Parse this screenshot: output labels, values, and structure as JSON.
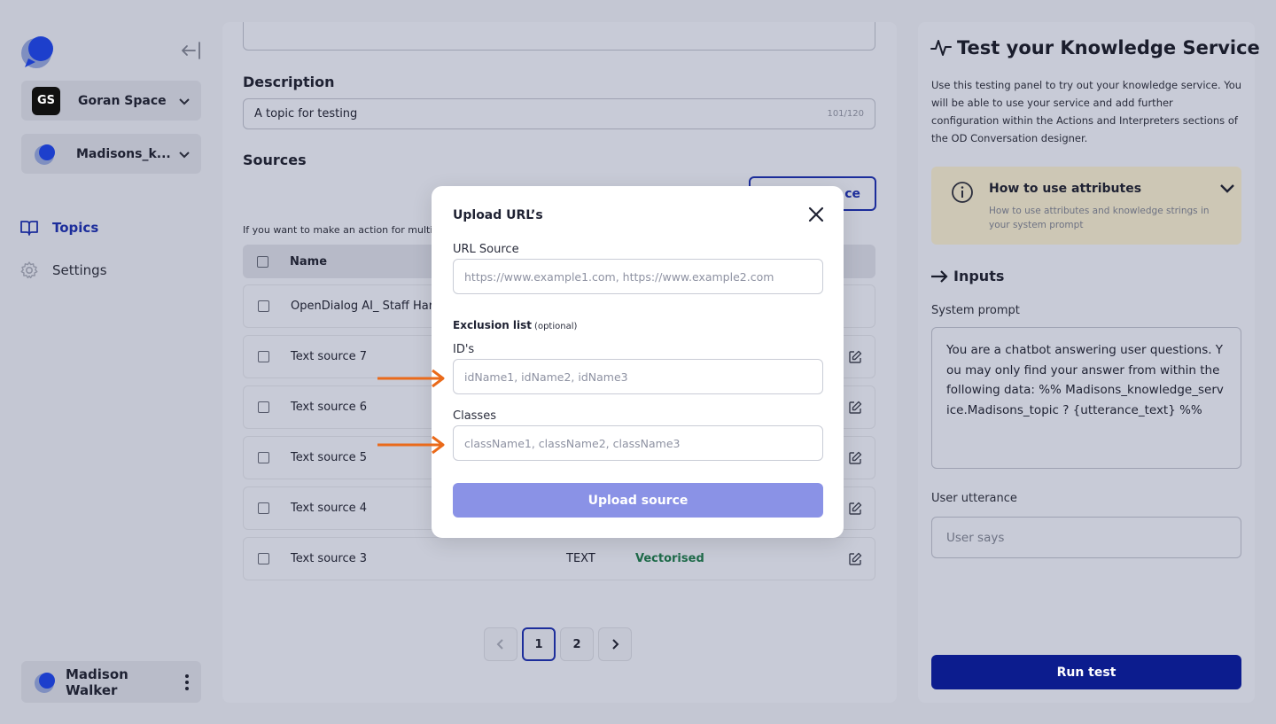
{
  "sidebar": {
    "workspace": {
      "initials": "GS",
      "name": "Goran Space"
    },
    "service": {
      "name": "Madisons_k..."
    },
    "nav": [
      {
        "label": "Topics",
        "icon": "book-icon",
        "active": true
      },
      {
        "label": "Settings",
        "icon": "gear-icon",
        "active": false
      }
    ],
    "user": {
      "name": "Madison Walker"
    }
  },
  "main": {
    "description_label": "Description",
    "description_value": "A topic for testing",
    "description_count": "101/120",
    "sources_label": "Sources",
    "add_source_label": "ce",
    "hint": "If you want to make an action for multip",
    "table": {
      "header_name": "Name",
      "rows": [
        {
          "name": "OpenDialog AI_ Staff Har",
          "type": "",
          "status": ""
        },
        {
          "name": "Text source 7",
          "type": "",
          "status": ""
        },
        {
          "name": "Text source 6",
          "type": "",
          "status": ""
        },
        {
          "name": "Text source 5",
          "type": "",
          "status": ""
        },
        {
          "name": "Text source 4",
          "type": "",
          "status": ""
        },
        {
          "name": "Text source 3",
          "type": "TEXT",
          "status": "Vectorised"
        }
      ]
    },
    "pagination": {
      "pages": [
        "1",
        "2"
      ],
      "current": "1"
    }
  },
  "right_panel": {
    "title": "Test your Knowledge Service",
    "description": "Use this testing panel to try out your knowledge service. You will be able to use your service and add further configuration within the Actions and Interpreters sections of the OD Conversation designer.",
    "attributes": {
      "title": "How to use attributes",
      "subtitle": "How to use attributes and knowledge strings in your system prompt"
    },
    "inputs_heading": "Inputs",
    "system_prompt_label": "System prompt",
    "system_prompt_value": "You are a chatbot answering user questions. You may only find your answer from within the following data: %% Madisons_knowledge_service.Madisons_topic ? {utterance_text} %%",
    "user_utterance_label": "User utterance",
    "user_utterance_placeholder": "User says",
    "run_button": "Run test"
  },
  "modal": {
    "title": "Upload URL’s",
    "url_source_label": "URL Source",
    "url_source_placeholder": "https://www.example1.com, https://www.example2.com",
    "exclusion_label": "Exclusion list",
    "exclusion_optional": "(optional)",
    "ids_label": "ID's",
    "ids_placeholder": "idName1, idName2, idName3",
    "classes_label": "Classes",
    "classes_placeholder": "className1, className2, className3",
    "upload_button": "Upload source"
  },
  "colors": {
    "primary": "#0c1c8e",
    "active_nav": "#1c2d9b",
    "upload_disabled": "#8a92e6",
    "status_vectorised": "#1f6b4a",
    "annotation_arrow": "#ea6a1a",
    "attributes_box": "#cdc7b5"
  }
}
